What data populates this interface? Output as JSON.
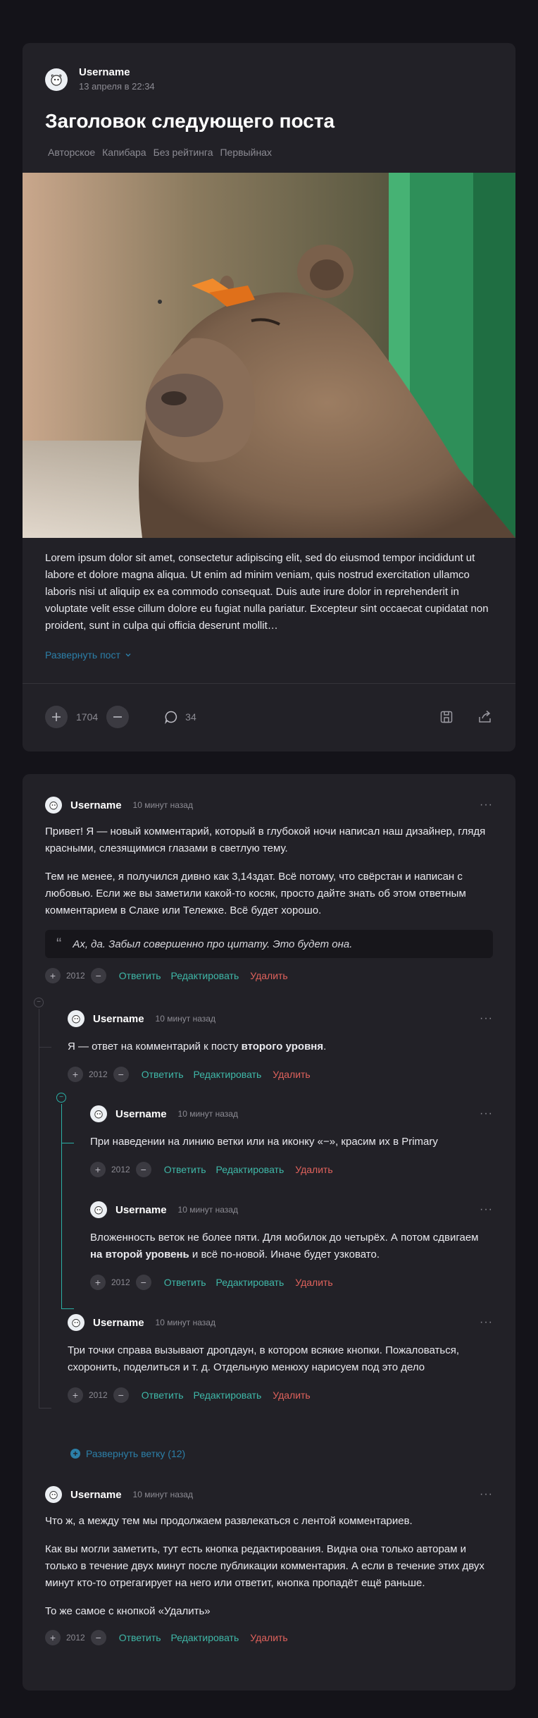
{
  "post": {
    "username": "Username",
    "date": "13 апреля в 22:34",
    "title": "Заголовок следующего поста",
    "tags": [
      "Авторское",
      "Капибара",
      "Без рейтинга",
      "Первыйнах"
    ],
    "text": "Lorem ipsum dolor sit amet, consectetur adipiscing elit, sed do eiusmod tempor incididunt ut labore et dolore magna aliqua. Ut enim ad minim veniam, quis nostrud exercitation ullamco laboris nisi ut aliquip ex ea commodo consequat. Duis aute irure dolor in reprehenderit in voluptate velit esse cillum dolore eu fugiat nulla pariatur. Excepteur sint occaecat cupidatat non proident, sunt in culpa qui officia deserunt mollit…",
    "expand_label": "Развернуть пост",
    "rating": "1704",
    "comments_count": "34"
  },
  "labels": {
    "reply": "Ответить",
    "edit": "Редактировать",
    "delete": "Удалить",
    "dots": "···"
  },
  "colors": {
    "accent": "#3fb8a8",
    "delete": "#e0625c",
    "link": "#2c7fa8",
    "branch_highlight": "#2bb0a6"
  },
  "comments": [
    {
      "username": "Username",
      "ago": "10 минут назад",
      "paragraphs": [
        "Привет! Я — новый комментарий, который в глубокой ночи написал наш дизайнер, глядя красными, слезящимися глазами в светлую тему.",
        "Тем не менее, я получился дивно как 3,14здат. Всё потому, что свёрстан и написан с любовью. Если же вы заметили какой-то косяк, просто дайте знать об этом ответным комментарием в Слаке или Тележке. Всё будет хорошо."
      ],
      "quote": "Ах, да. Забыл совершенно про цитату. Это будет она.",
      "rating": "2012"
    },
    {
      "username": "Username",
      "ago": "10 минут назад",
      "text_before": "Я — ответ на комментарий к посту ",
      "text_bold": "второго уровня",
      "text_after": ".",
      "rating": "2012"
    },
    {
      "username": "Username",
      "ago": "10 минут назад",
      "text": "При наведении на линию ветки или на иконку «−», красим их в Primary",
      "rating": "2012"
    },
    {
      "username": "Username",
      "ago": "10 минут назад",
      "text_before": "Вложенность веток не более пяти. Для мобилок до четырёх. А потом сдвигаем ",
      "text_bold": "на второй уровень",
      "text_after": " и всё по-новой. Иначе будет узковато.",
      "rating": "2012"
    },
    {
      "username": "Username",
      "ago": "10 минут назад",
      "text": "Три точки справа вызывают дропдаун, в котором всякие кнопки. Пожаловаться, схоронить, поделиться и т. д. Отдельную менюху нарисуем под это дело",
      "rating": "2012"
    },
    {
      "username": "Username",
      "ago": "10 минут назад",
      "paragraphs": [
        "Что ж, а между тем мы продолжаем развлекаться с лентой комментариев.",
        "Как вы могли заметить, тут есть кнопка редактирования. Видна она только авторам и только в течение двух минут после публикации комментария. А если в течение этих двух минут кто-то отрегагирует на него или ответит, кнопка пропадёт ещё раньше.",
        "То же самое с кнопкой «Удалить»"
      ],
      "rating": "2012"
    }
  ],
  "expand_branch": "Развернуть ветку (12)"
}
